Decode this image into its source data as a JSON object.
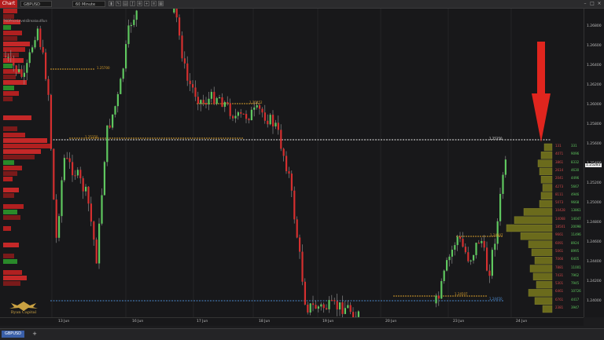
{
  "titlebar": {
    "tab_label": "Chart",
    "instrument": "GBPUSD",
    "timeframe": "60 Minute"
  },
  "indicator_label": "TKOPriceLevelsBreakoutRun",
  "price_axis": {
    "labels": [
      "1.26800",
      "1.26600",
      "1.26400",
      "1.26200",
      "1.26000",
      "1.25800",
      "1.25600",
      "1.25400",
      "1.25200",
      "1.25000",
      "1.24800",
      "1.24600",
      "1.24400",
      "1.24200",
      "1.24000"
    ],
    "current_price": "1.25281"
  },
  "time_axis": {
    "labels": [
      "13 Jun",
      "16 Jun",
      "17 Jun",
      "18 Jun",
      "19 Jun",
      "20 Jun",
      "23 Jun",
      "24 Jun"
    ]
  },
  "level_labels": {
    "upper_left": "1.25700",
    "upper_mid": "1.25452",
    "dashed_white": "1.25350",
    "orange_left": "1.25350",
    "mid_orange": "1.24807",
    "lower_orange": "1.24507",
    "blue_level": "1.24450"
  },
  "volume_profile": {
    "rows": [
      {
        "left": "131",
        "right": "331"
      },
      {
        "left": "4071",
        "right": "9096"
      },
      {
        "left": "3861",
        "right": "8332"
      },
      {
        "left": "2614",
        "right": "4630"
      },
      {
        "left": "2041",
        "right": "4496"
      },
      {
        "left": "4273",
        "right": "5667"
      },
      {
        "left": "8111",
        "right": "4946"
      },
      {
        "left": "5073",
        "right": "9668"
      },
      {
        "left": "10428",
        "right": "13861"
      },
      {
        "left": "14068",
        "right": "14047"
      },
      {
        "left": "18501",
        "right": "20098"
      },
      {
        "left": "9661",
        "right": "11496"
      },
      {
        "left": "6091",
        "right": "8924"
      },
      {
        "left": "5061",
        "right": "8995"
      },
      {
        "left": "7066",
        "right": "6405"
      },
      {
        "left": "7881",
        "right": "11001"
      },
      {
        "left": "7431",
        "right": "7962"
      },
      {
        "left": "5301",
        "right": "7945"
      },
      {
        "left": "6461",
        "right": "10726"
      },
      {
        "left": "6761",
        "right": "4417"
      },
      {
        "left": "2381",
        "right": "3947"
      }
    ]
  },
  "copyright": "© 2021 NinjaTrader, LLC",
  "logo_text": "Ryan Capital",
  "bottom_bar": {
    "tab_label": "GBPUSD",
    "add_tab": "+"
  },
  "colors": {
    "bull": "#5fc75f",
    "bear": "#d42f2f",
    "profile_olive": "#6b6b1c",
    "arrow": "#e0251e",
    "orange_level": "#d29a2a",
    "blue_level": "#4a86c9"
  }
}
